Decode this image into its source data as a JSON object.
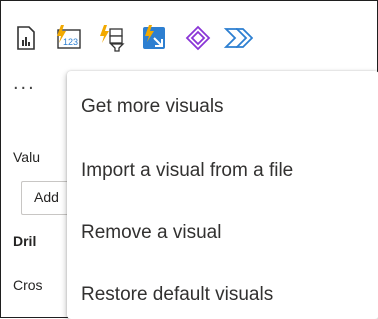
{
  "toolbar": {
    "icons": [
      {
        "name": "report-visual-icon"
      },
      {
        "name": "card-number-visual-icon",
        "text": "123"
      },
      {
        "name": "slicer-visual-icon"
      },
      {
        "name": "key-influencers-visual-icon"
      },
      {
        "name": "custom-visual-diamond-icon"
      },
      {
        "name": "power-automate-icon"
      }
    ],
    "more_label": "..."
  },
  "pane": {
    "values_label": "Valu",
    "add_field_label": "Add",
    "drill_label": "Dril",
    "cross_label": "Cros"
  },
  "menu": {
    "items": [
      {
        "label": "Get more visuals"
      },
      {
        "label": "Import a visual from a file"
      },
      {
        "label": "Remove a visual"
      },
      {
        "label": "Restore default visuals"
      }
    ]
  },
  "colors": {
    "lightning": "#f2a900",
    "accent_purple": "#8a35d6",
    "accent_blue": "#2d7fd1",
    "text": "#252423"
  }
}
